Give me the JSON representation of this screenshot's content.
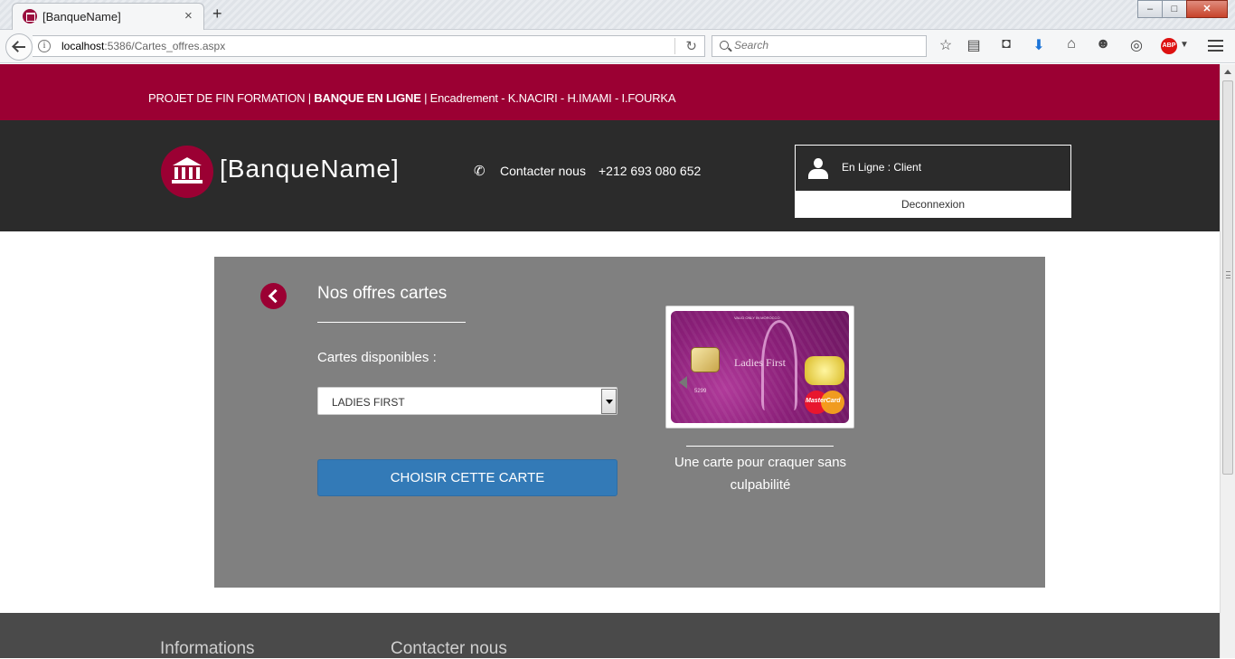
{
  "browser": {
    "tab_title": "[BanqueName]",
    "tab_close": "×",
    "new_tab": "+",
    "url_host": "localhost",
    "url_rest": ":5386/Cartes_offres.aspx",
    "search_placeholder": "Search",
    "window_buttons": {
      "minimize": "–",
      "maximize": "□",
      "close": "✕"
    },
    "tools": [
      "star-icon",
      "reading-list-icon",
      "pocket-icon",
      "download-icon",
      "home-icon",
      "chat-icon",
      "globe-icon"
    ],
    "abp": "ABP"
  },
  "topband": {
    "part1": "PROJET DE FIN FORMATION | ",
    "bold": "BANQUE EN LIGNE",
    "part2": " | Encadrement - K.NACIRI - H.IMAMI - I.FOURKA"
  },
  "header": {
    "brand": "[BanqueName]",
    "contact_label": "Contacter nous",
    "contact_number": "+212 693 080 652",
    "user_status": "En Ligne : Client",
    "logout": "Deconnexion"
  },
  "offers": {
    "title": "Nos offres cartes",
    "cards_label": "Cartes disponibles :",
    "selected_card": "LADIES FIRST",
    "choose_button": "CHOISIR CETTE CARTE",
    "caption": "Une carte pour craquer sans culpabilité",
    "card_brand": "Ladies First",
    "card_mc": "MasterCard",
    "card_num": "5299",
    "card_tiny": "VALID ONLY IN MOROCCO"
  },
  "footer": {
    "col1": "Informations",
    "col2": "Contacter nous"
  },
  "colors": {
    "brand": "#9b0033",
    "header_bg": "#2b2b2b",
    "panel_bg": "#808080",
    "button": "#337ab7"
  }
}
